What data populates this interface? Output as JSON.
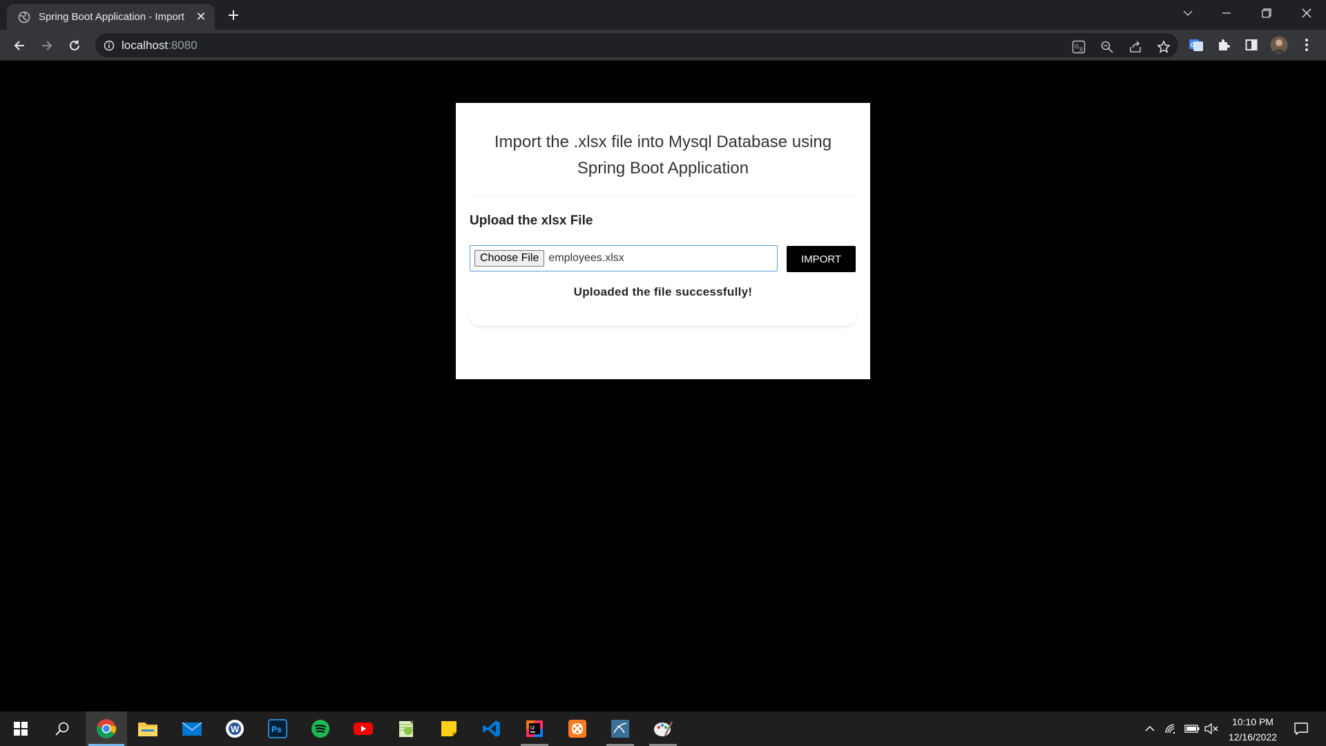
{
  "browser": {
    "tab_title": "Spring Boot Application - Import",
    "url_host": "localhost",
    "url_port": ":8080"
  },
  "page": {
    "title_line1": "Import the .xlsx file into Mysql Database using",
    "title_line2": "Spring Boot Application",
    "upload_label": "Upload the xlsx File",
    "choose_file_label": "Choose File",
    "file_name": "employees.xlsx",
    "import_label": "IMPORT",
    "status_message": "Uploaded the file successfully!"
  },
  "taskbar": {
    "apps": [
      "chrome-icon",
      "file-explorer-icon",
      "mail-icon",
      "word-icon",
      "photoshop-icon",
      "spotify-icon",
      "youtube-icon",
      "notepad-plus-plus-icon",
      "sticky-notes-icon",
      "vscode-icon",
      "intellij-icon",
      "xampp-icon",
      "mysql-workbench-icon",
      "paint-icon"
    ],
    "time": "10:10 PM",
    "date": "12/16/2022"
  },
  "colors": {
    "chrome_dark": "#202124",
    "toolbar": "#35363a",
    "accent_blue": "#76b9ed"
  }
}
